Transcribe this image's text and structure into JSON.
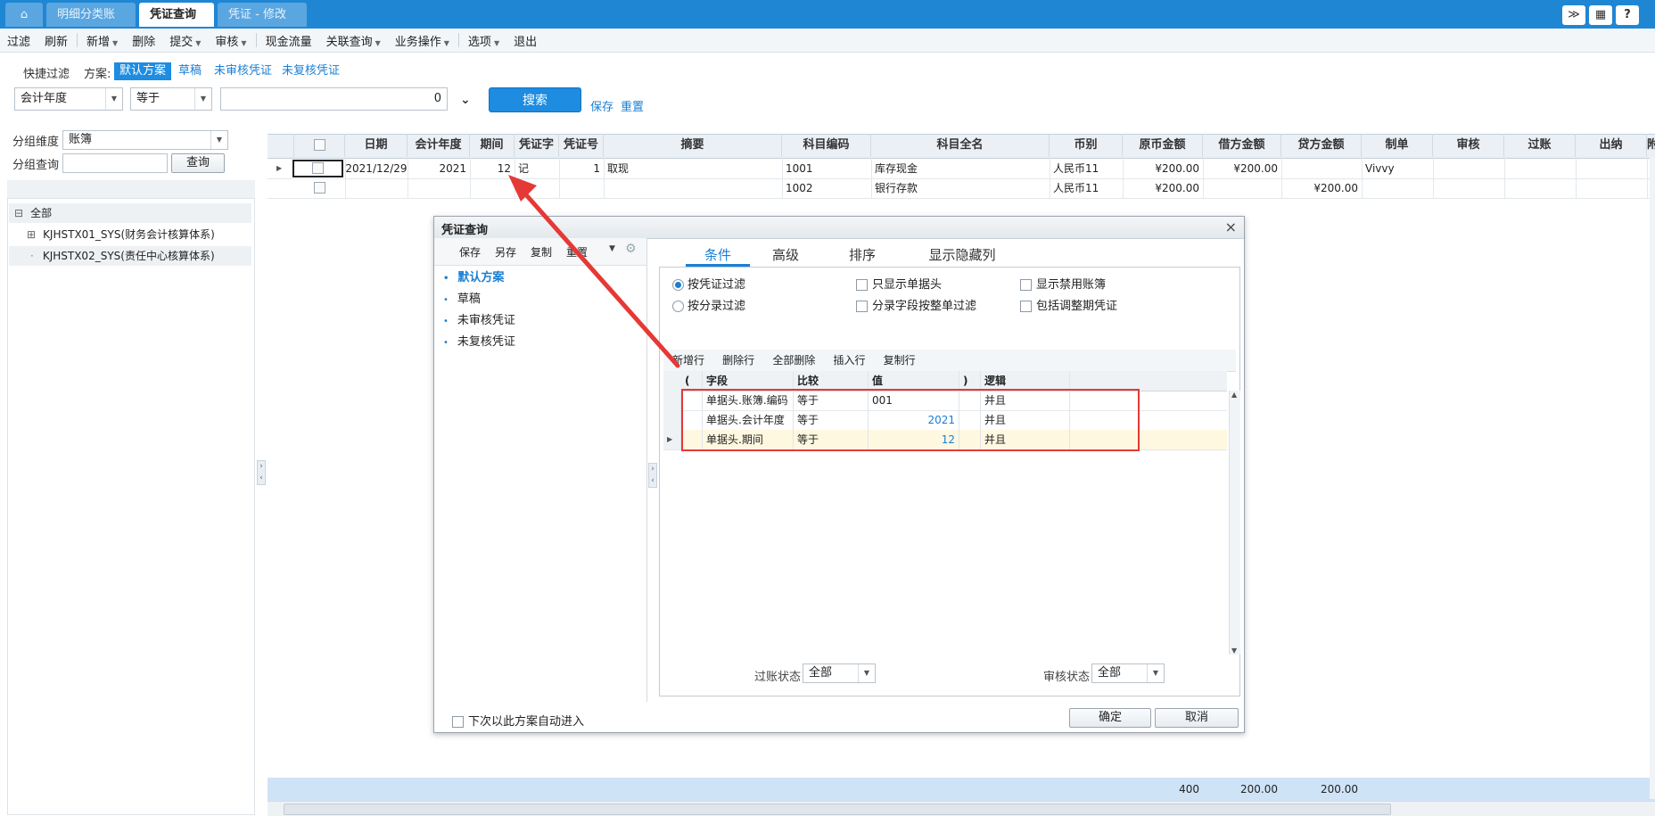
{
  "tabs": [
    {
      "label": "明细分类账",
      "active": false
    },
    {
      "label": "凭证查询",
      "active": true,
      "close": "×"
    },
    {
      "label": "凭证 - 修改",
      "active": false
    }
  ],
  "icons": {
    "home": "⌂",
    "expand": "≫",
    "grid": "▦",
    "help": "?",
    "double_down": "¥"
  },
  "menu": {
    "filter": "过滤",
    "refresh": "刷新",
    "add": "新增",
    "delete": "删除",
    "submit": "提交",
    "audit": "审核",
    "cashflow": "现金流量",
    "related": "关联查询",
    "business": "业务操作",
    "options": "选项",
    "exit": "退出"
  },
  "quick": {
    "label": "快捷过滤",
    "plan_label": "方案:",
    "plans": [
      "默认方案",
      "草稿",
      "未审核凭证",
      "未复核凭证"
    ],
    "field": "会计年度",
    "operator": "等于",
    "value": "0",
    "search": "搜索",
    "save": "保存",
    "reset": "重置"
  },
  "left": {
    "group_dim_label": "分组维度",
    "group_dim_value": "账簿",
    "group_query_label": "分组查询",
    "query_button": "查询",
    "tree": [
      {
        "label": "全部",
        "mark": "⊟"
      },
      {
        "label": "KJHSTX01_SYS(财务会计核算体系)",
        "mark": "⊞"
      },
      {
        "label": "KJHSTX02_SYS(责任中心核算体系)",
        "mark": "·"
      }
    ]
  },
  "grid": {
    "headers": [
      "日期",
      "会计年度",
      "期间",
      "凭证字",
      "凭证号",
      "摘要",
      "科目编码",
      "科目全名",
      "币别",
      "原币金额",
      "借方金额",
      "贷方金额",
      "制单",
      "审核",
      "过账",
      "出纳",
      "附"
    ],
    "rows": [
      {
        "date": "2021/12/29",
        "year": "2021",
        "period": "12",
        "word": "记",
        "no": "1",
        "summary": "取现",
        "code": "1001",
        "name": "库存现金",
        "currency": "人民币11",
        "orig": "¥200.00",
        "debit": "¥200.00",
        "credit": "",
        "maker": "Vivvy"
      },
      {
        "date": "",
        "year": "",
        "period": "",
        "word": "",
        "no": "",
        "summary": "",
        "code": "1002",
        "name": "银行存款",
        "currency": "人民币11",
        "orig": "¥200.00",
        "debit": "",
        "credit": "¥200.00",
        "maker": ""
      }
    ],
    "totals": {
      "orig": "400",
      "debit": "200.00",
      "credit": "200.00"
    }
  },
  "dialog": {
    "title": "凭证查询",
    "close": "×",
    "toolbar": [
      "保存",
      "另存",
      "复制",
      "重置"
    ],
    "plans": [
      "默认方案",
      "草稿",
      "未审核凭证",
      "未复核凭证"
    ],
    "tabs": [
      "条件",
      "高级",
      "排序",
      "显示隐藏列"
    ],
    "options": {
      "by_voucher": "按凭证过滤",
      "by_entry": "按分录过滤",
      "only_header": "只显示单据头",
      "entry_field": "分录字段按整单过滤",
      "show_disabled": "显示禁用账簿",
      "include_adjust": "包括调整期凭证"
    },
    "cond_toolbar": [
      "新增行",
      "删除行",
      "全部删除",
      "插入行",
      "复制行"
    ],
    "cond_headers": [
      "(",
      "字段",
      "比较",
      "值",
      ")",
      "逻辑"
    ],
    "conditions": [
      {
        "field": "单据头.账簿.编码",
        "op": "等于",
        "value": "001",
        "logic": "并且"
      },
      {
        "field": "单据头.会计年度",
        "op": "等于",
        "value": "2021",
        "logic": "并且"
      },
      {
        "field": "单据头.期间",
        "op": "等于",
        "value": "12",
        "logic": "并且"
      }
    ],
    "post_status_label": "过账状态",
    "post_status": "全部",
    "audit_status_label": "审核状态",
    "audit_status": "全部",
    "auto_enter": "下次以此方案自动进入",
    "ok": "确定",
    "cancel": "取消"
  },
  "colors": {
    "accent": "#1e8ce0",
    "annotation": "#e53935"
  }
}
